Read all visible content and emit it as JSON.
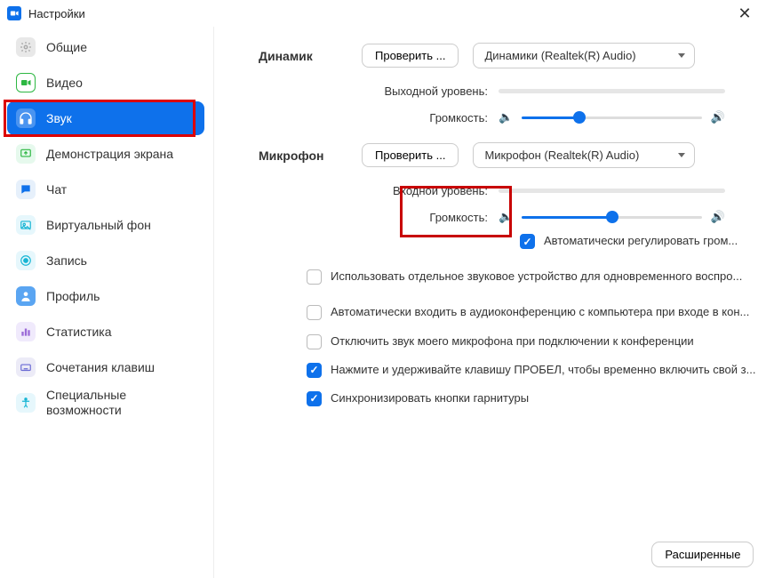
{
  "window": {
    "title": "Настройки"
  },
  "sidebar": {
    "items": [
      {
        "label": "Общие"
      },
      {
        "label": "Видео"
      },
      {
        "label": "Звук"
      },
      {
        "label": "Демонстрация экрана"
      },
      {
        "label": "Чат"
      },
      {
        "label": "Виртуальный фон"
      },
      {
        "label": "Запись"
      },
      {
        "label": "Профиль"
      },
      {
        "label": "Статистика"
      },
      {
        "label": "Сочетания клавиш"
      },
      {
        "label": "Специальные возможности"
      }
    ]
  },
  "audio": {
    "speaker": {
      "section_label": "Динамик",
      "test_label": "Проверить ...",
      "device": "Динамики (Realtek(R) Audio)",
      "output_level_label": "Выходной уровень:",
      "volume_label": "Громкость:",
      "volume_percent": 32
    },
    "microphone": {
      "section_label": "Микрофон",
      "test_label": "Проверить ...",
      "device": "Микрофон (Realtek(R) Audio)",
      "input_level_label": "Входной уровень:",
      "volume_label": "Громкость:",
      "volume_percent": 50,
      "auto_adjust_label": "Автоматически регулировать гром...",
      "auto_adjust_checked": true
    },
    "options": [
      {
        "label": "Использовать отдельное звуковое устройство для одновременного воспро...",
        "checked": false
      },
      {
        "label": "Автоматически входить в аудиоконференцию с компьютера при входе в кон...",
        "checked": false
      },
      {
        "label": "Отключить звук моего микрофона при подключении к конференции",
        "checked": false
      },
      {
        "label": "Нажмите и удерживайте клавишу ПРОБЕЛ, чтобы временно включить свой з...",
        "checked": true
      },
      {
        "label": "Синхронизировать кнопки гарнитуры",
        "checked": true
      }
    ],
    "advanced_button": "Расширенные"
  }
}
